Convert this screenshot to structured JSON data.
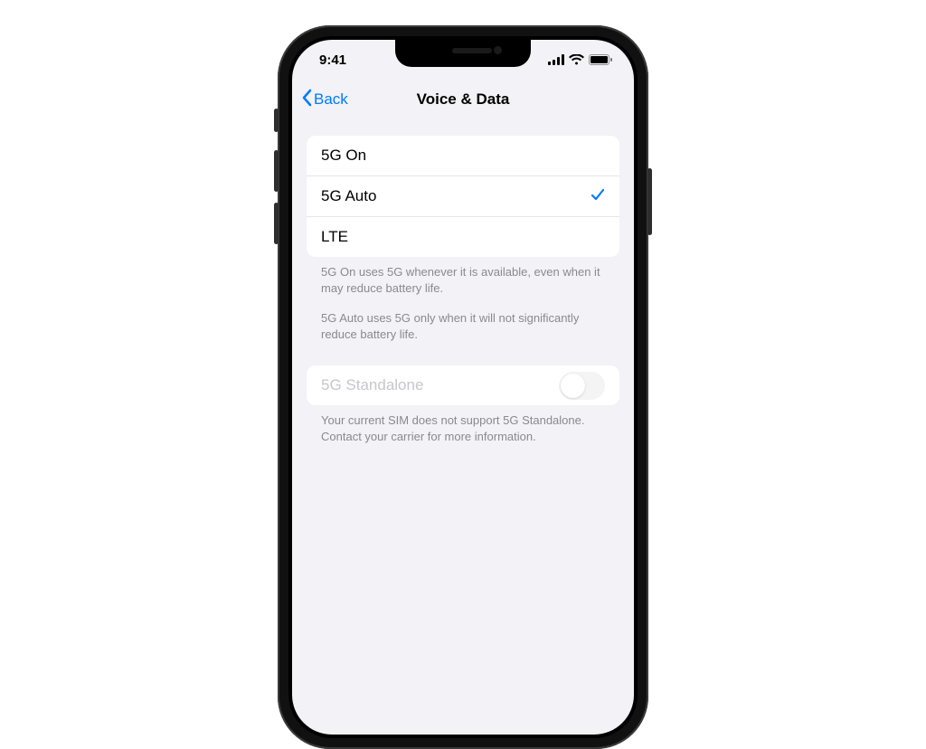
{
  "statusbar": {
    "time": "9:41"
  },
  "navbar": {
    "back_label": "Back",
    "title": "Voice & Data"
  },
  "options": [
    {
      "label": "5G On",
      "selected": false
    },
    {
      "label": "5G Auto",
      "selected": true
    },
    {
      "label": "LTE",
      "selected": false
    }
  ],
  "footers": {
    "explain_5g_on": "5G On uses 5G whenever it is available, even when it may reduce battery life.",
    "explain_5g_auto": "5G Auto uses 5G only when it will not significantly reduce battery life."
  },
  "standalone": {
    "label": "5G Standalone",
    "enabled": false,
    "footer": "Your current SIM does not support 5G Standalone. Contact your carrier for more information."
  },
  "colors": {
    "accent": "#007aff",
    "bg": "#f2f2f7"
  }
}
